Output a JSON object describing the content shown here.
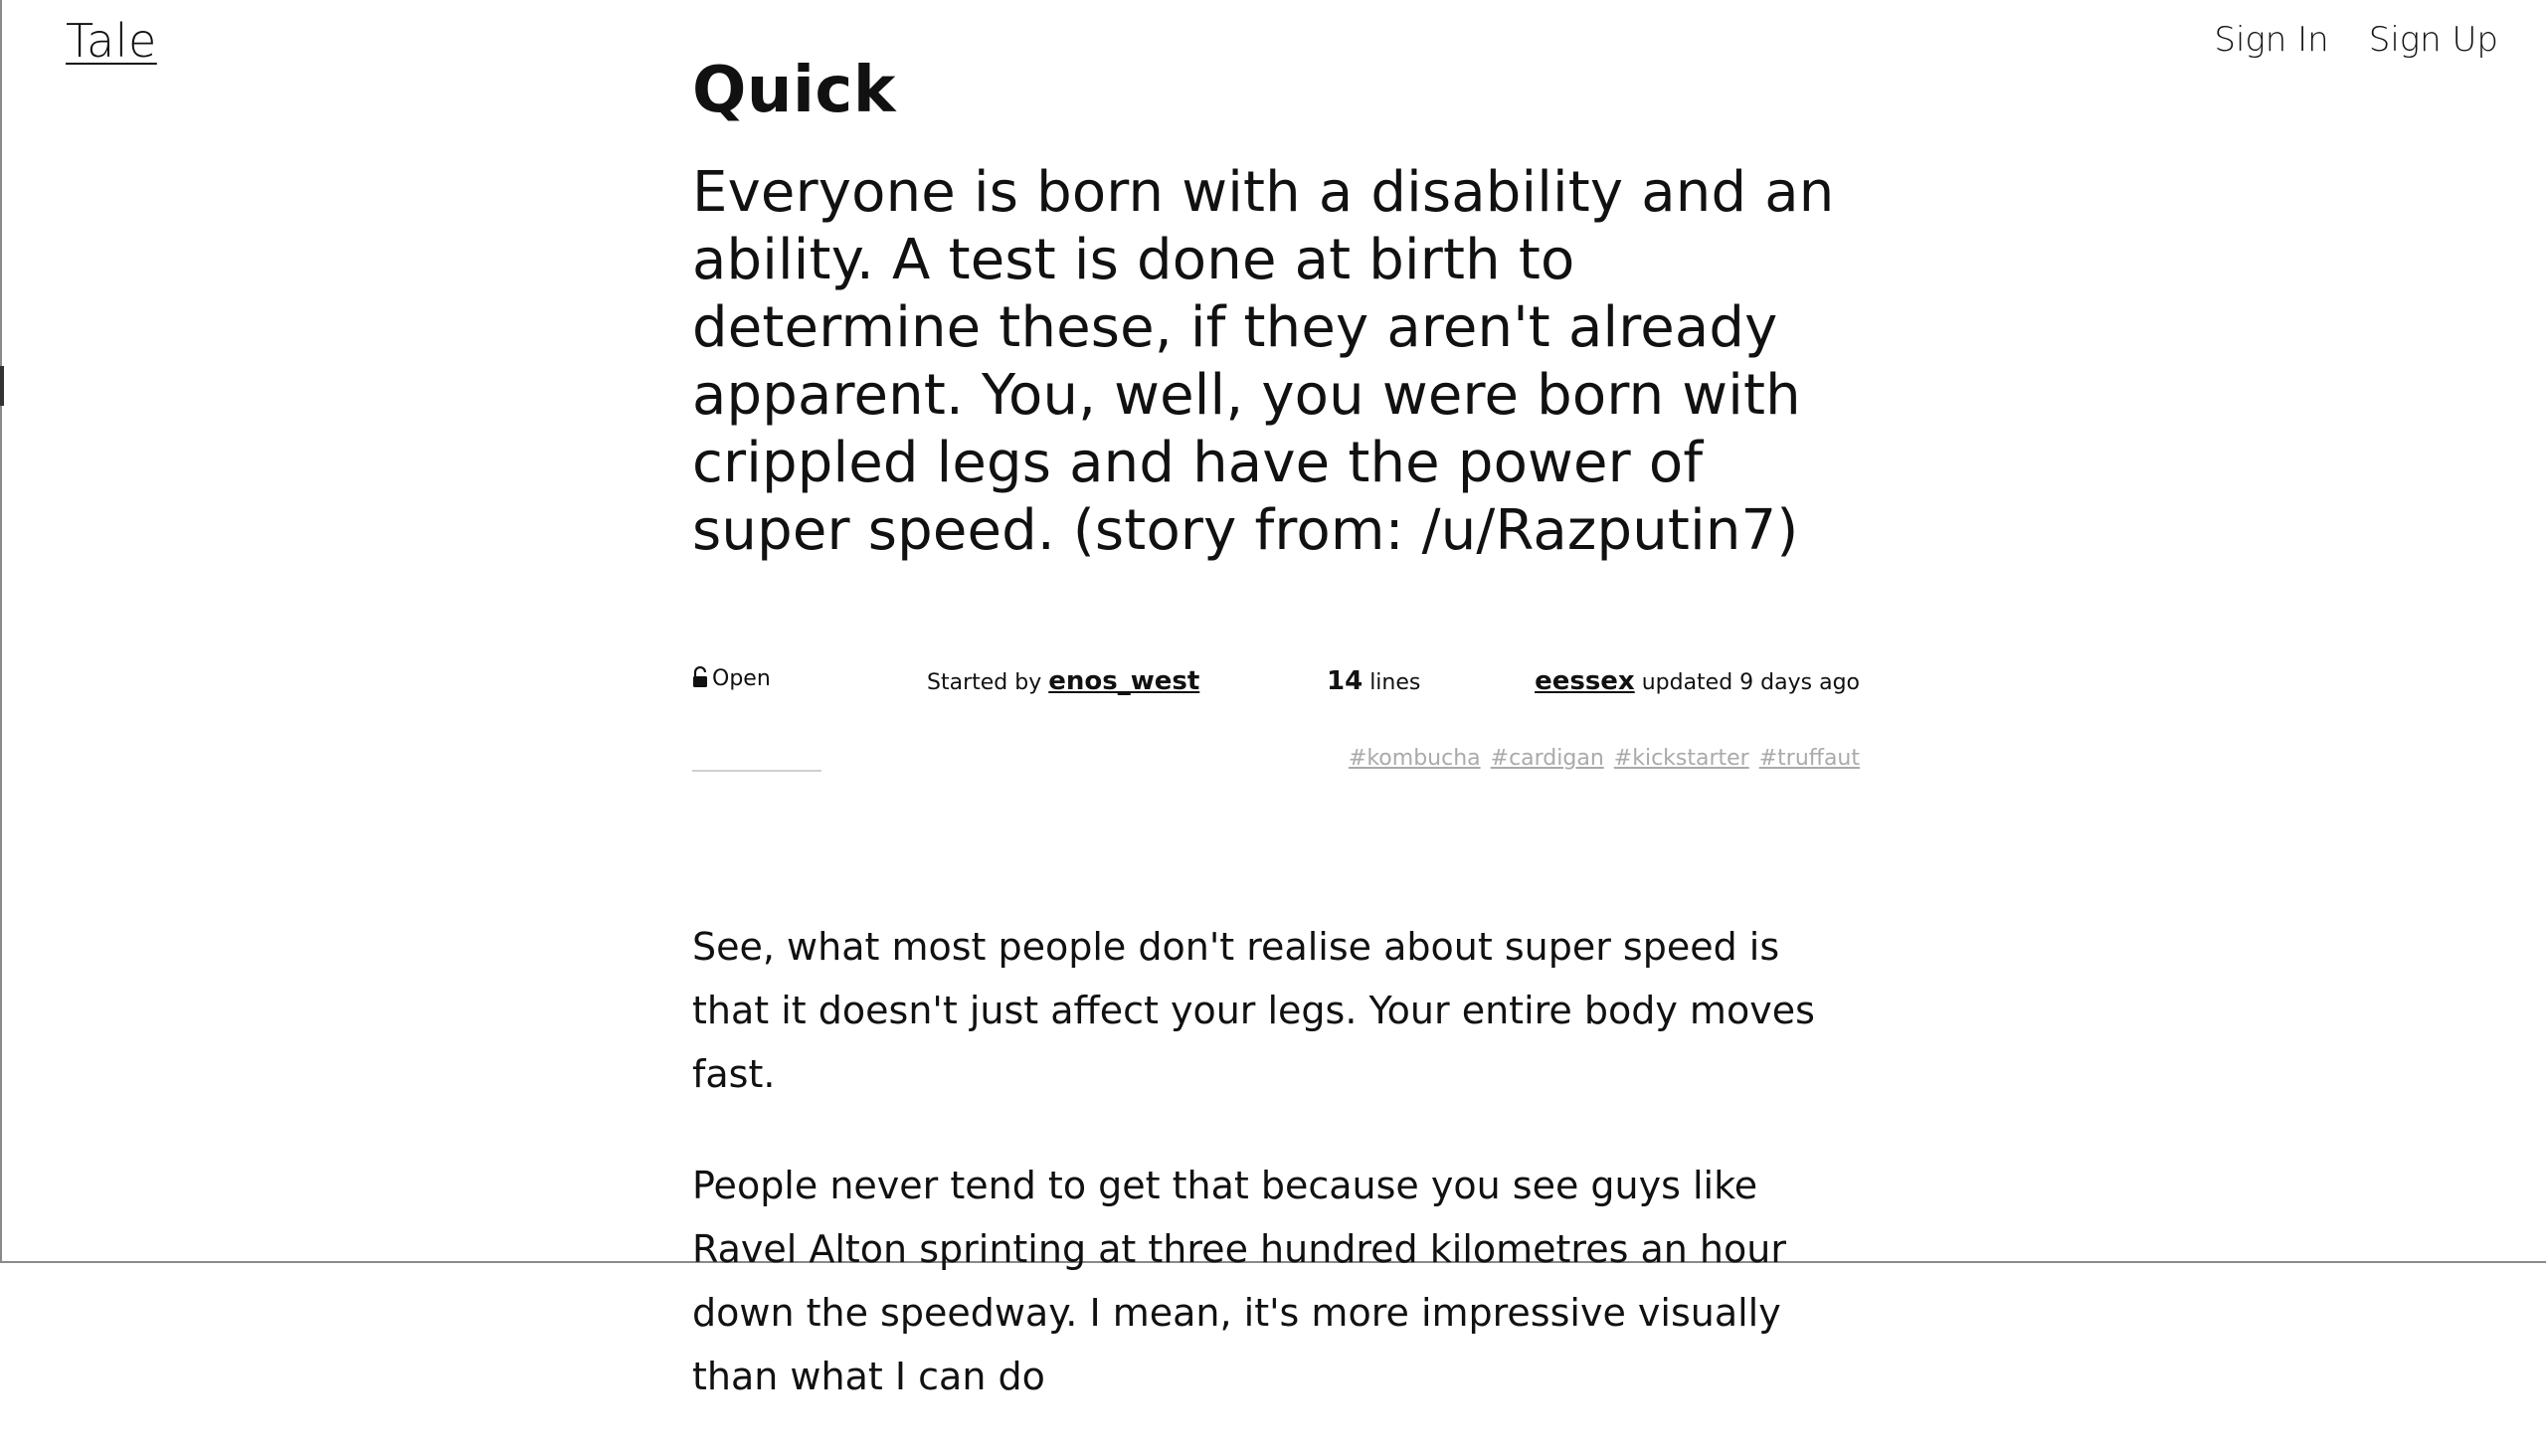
{
  "header": {
    "logo": "Tale",
    "sign_in": "Sign In",
    "sign_up": "Sign Up"
  },
  "story": {
    "title": "Quick",
    "prompt": "Everyone is born with a disability and an ability. A test is done at birth to determine these, if they aren't already apparent. You, well, you were born with crippled legs and have the power of super speed. (story from: /u/Razputin7)",
    "status": "Open",
    "started_by_label": "Started by",
    "starter": "enos_west",
    "line_count": "14",
    "lines_label": "lines",
    "updater": "eessex",
    "updated_text": "updated 9 days ago",
    "tags": [
      "#kombucha",
      "#cardigan",
      "#kickstarter",
      "#truffaut"
    ],
    "paragraphs": [
      "See, what most people don't realise about super speed is that it doesn't just affect your legs. Your entire body moves fast.",
      "People never tend to get that because you see guys like Ravel Alton sprinting at three hundred kilometres an hour down the speedway. I mean, it's more impressive visually than what I can do"
    ]
  }
}
